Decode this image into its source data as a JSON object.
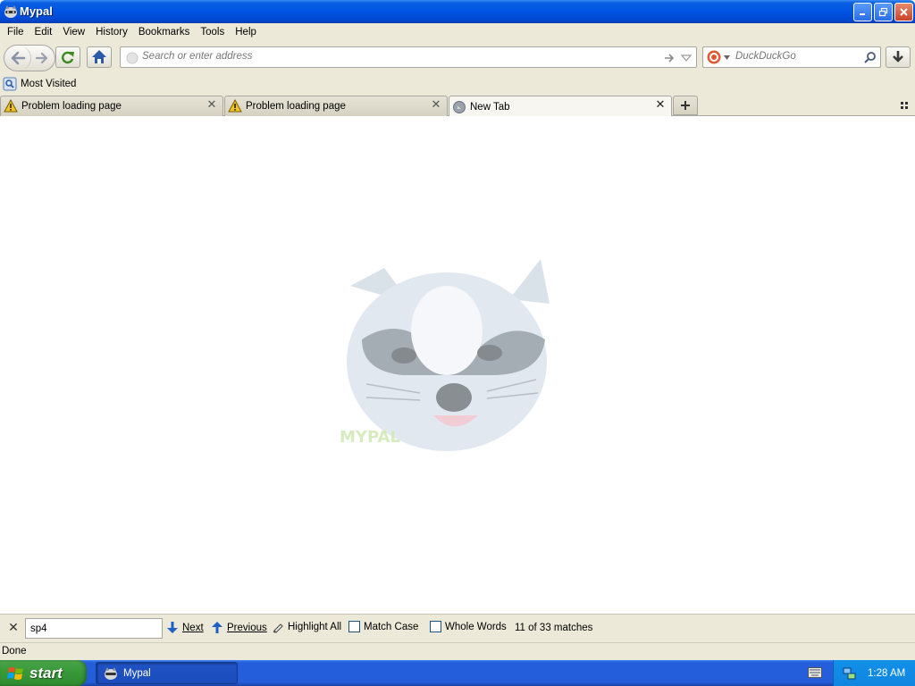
{
  "window": {
    "title": "Mypal"
  },
  "menu": [
    "File",
    "Edit",
    "View",
    "History",
    "Bookmarks",
    "Tools",
    "Help"
  ],
  "navbar": {
    "url_placeholder": "Search or enter address",
    "search_placeholder": "DuckDuckGo"
  },
  "bookmarks": {
    "most_visited": "Most Visited"
  },
  "tabs": [
    {
      "label": "Problem loading page",
      "icon": "warning-icon",
      "active": false
    },
    {
      "label": "Problem loading page",
      "icon": "warning-icon",
      "active": false
    },
    {
      "label": "New Tab",
      "icon": "globe-icon",
      "active": true
    }
  ],
  "content": {
    "logo_text": "MYPAL"
  },
  "findbar": {
    "query": "sp4",
    "next": "Next",
    "previous": "Previous",
    "highlight_all": "Highlight All",
    "match_case": "Match Case",
    "whole_words": "Whole Words",
    "status": "11 of 33 matches"
  },
  "statusbar": {
    "text": "Done"
  },
  "taskbar": {
    "start": "start",
    "task": "Mypal",
    "clock": "1:28 AM"
  },
  "colors": {
    "titlebar": "#0054e3",
    "chrome": "#ece9d8",
    "taskbar": "#245edb",
    "start": "#3a9a3a",
    "tray": "#0f86e0"
  }
}
